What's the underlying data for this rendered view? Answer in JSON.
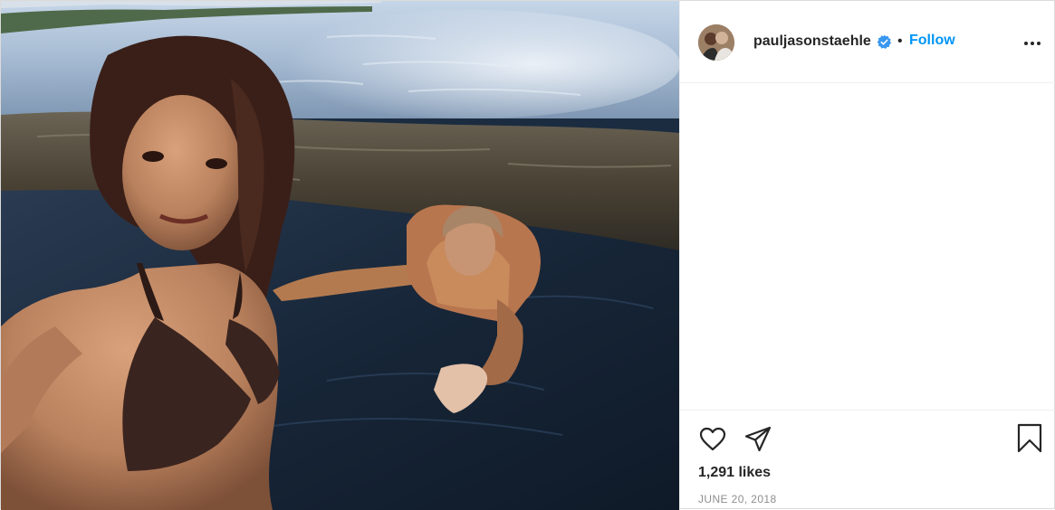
{
  "post": {
    "username": "pauljasonstaehle",
    "separator": "•",
    "follow_label": "Follow",
    "likes": "1,291 likes",
    "date": "JUNE 20, 2018"
  },
  "icons": {
    "verified": "verified-badge-icon",
    "more": "more-options-icon",
    "like": "heart-icon",
    "share": "paper-plane-icon",
    "save": "bookmark-icon"
  },
  "colors": {
    "link": "#0095f6",
    "text": "#262626",
    "muted": "#8e8e8e",
    "border": "#efefef"
  }
}
